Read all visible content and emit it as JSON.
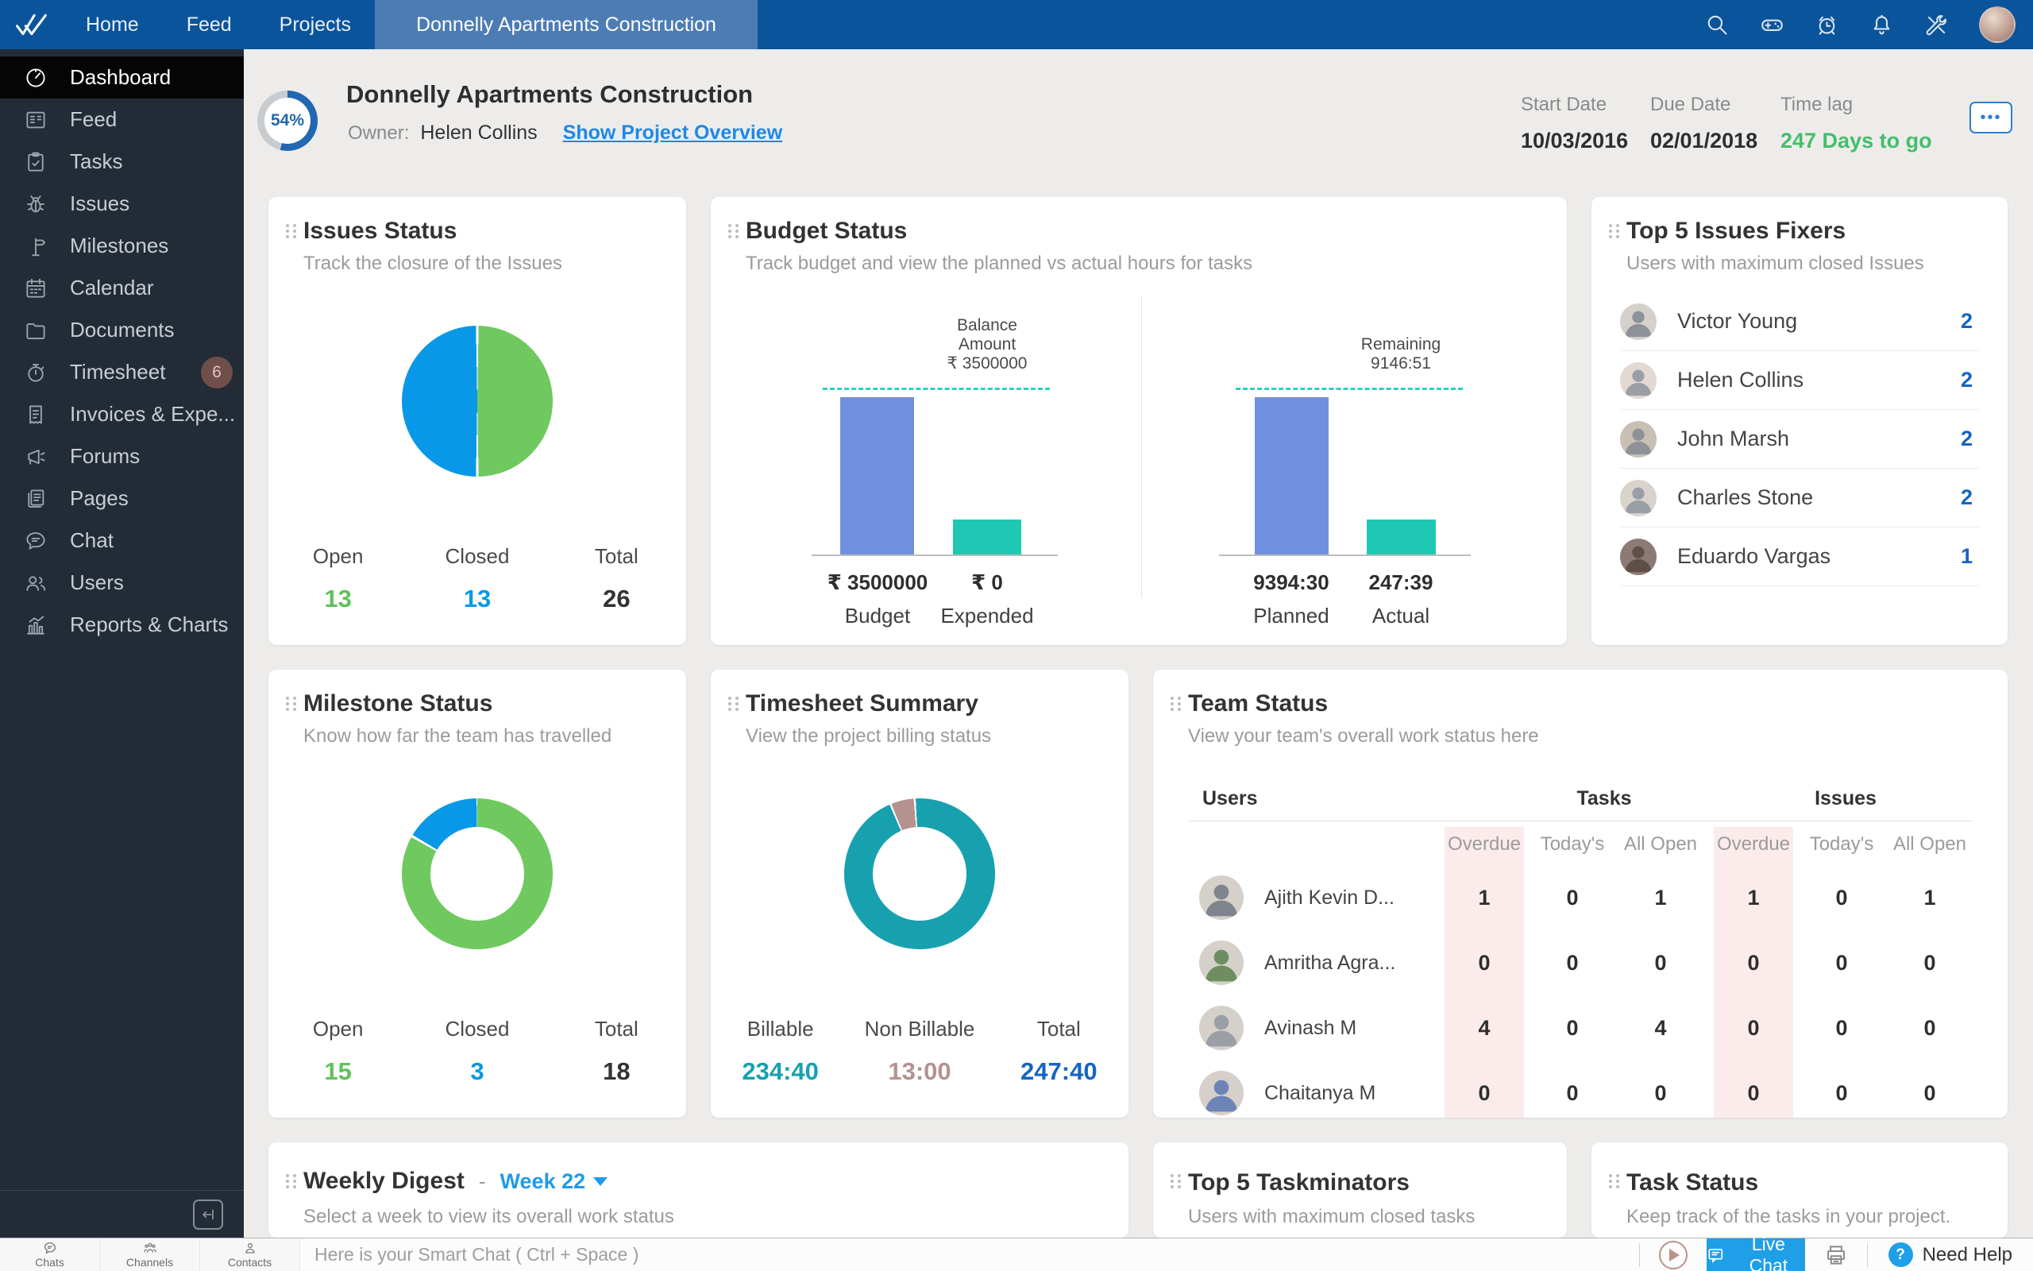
{
  "nav": {
    "tabs": [
      {
        "label": "Home"
      },
      {
        "label": "Feed"
      },
      {
        "label": "Projects"
      }
    ],
    "active_tab": "Donnelly Apartments Construction"
  },
  "sidebar": {
    "items": [
      {
        "label": "Dashboard"
      },
      {
        "label": "Feed"
      },
      {
        "label": "Tasks"
      },
      {
        "label": "Issues"
      },
      {
        "label": "Milestones"
      },
      {
        "label": "Calendar"
      },
      {
        "label": "Documents"
      },
      {
        "label": "Timesheet",
        "badge": "6"
      },
      {
        "label": "Invoices & Expe..."
      },
      {
        "label": "Forums"
      },
      {
        "label": "Pages"
      },
      {
        "label": "Chat"
      },
      {
        "label": "Users"
      },
      {
        "label": "Reports & Charts"
      }
    ]
  },
  "header": {
    "progress": "54%",
    "title": "Donnelly Apartments Construction",
    "owner_label": "Owner:",
    "owner_name": "Helen Collins",
    "overview_link": "Show Project Overview",
    "start_date_label": "Start Date",
    "start_date": "10/03/2016",
    "due_date_label": "Due Date",
    "due_date": "02/01/2018",
    "time_lag_label": "Time lag",
    "time_lag": "247 Days to go",
    "more_glyph": "•••"
  },
  "cards": {
    "issues_status": {
      "title": "Issues Status",
      "subtitle": "Track the closure of the Issues",
      "open_label": "Open",
      "open_value": "13",
      "closed_label": "Closed",
      "closed_value": "13",
      "total_label": "Total",
      "total_value": "26"
    },
    "budget_status": {
      "title": "Budget Status",
      "subtitle": "Track budget and view the planned vs actual hours for tasks",
      "money": {
        "annotation": [
          "Balance",
          "Amount",
          "₹ 3500000"
        ],
        "bar1_value": "₹ 3500000",
        "bar1_label": "Budget",
        "bar2_value": "₹ 0",
        "bar2_label": "Expended"
      },
      "hours": {
        "annotation": [
          "Remaining",
          "9146:51"
        ],
        "bar1_value": "9394:30",
        "bar1_label": "Planned",
        "bar2_value": "247:39",
        "bar2_label": "Actual"
      }
    },
    "top_issues_fixers": {
      "title": "Top 5 Issues Fixers",
      "subtitle": "Users with maximum closed Issues",
      "rows": [
        {
          "name": "Victor Young",
          "count": "2"
        },
        {
          "name": "Helen Collins",
          "count": "2"
        },
        {
          "name": "John Marsh",
          "count": "2"
        },
        {
          "name": "Charles Stone",
          "count": "2"
        },
        {
          "name": "Eduardo Vargas",
          "count": "1"
        }
      ]
    },
    "milestone_status": {
      "title": "Milestone Status",
      "subtitle": "Know how far the team has travelled",
      "open_label": "Open",
      "open_value": "15",
      "closed_label": "Closed",
      "closed_value": "3",
      "total_label": "Total",
      "total_value": "18"
    },
    "timesheet_summary": {
      "title": "Timesheet Summary",
      "subtitle": "View the project billing status",
      "billable_label": "Billable",
      "billable_value": "234:40",
      "non_billable_label": "Non Billable",
      "non_billable_value": "13:00",
      "total_label": "Total",
      "total_value": "247:40"
    },
    "team_status": {
      "title": "Team Status",
      "subtitle": "View your team's overall work status here",
      "users_header": "Users",
      "tasks_header": "Tasks",
      "issues_header": "Issues",
      "sub_headers": [
        "Overdue",
        "Today's",
        "All Open",
        "Overdue",
        "Today's",
        "All Open"
      ],
      "rows": [
        {
          "name": "Ajith Kevin D...",
          "values": [
            "1",
            "0",
            "1",
            "1",
            "0",
            "1"
          ]
        },
        {
          "name": "Amritha Agra...",
          "values": [
            "0",
            "0",
            "0",
            "0",
            "0",
            "0"
          ]
        },
        {
          "name": "Avinash M",
          "values": [
            "4",
            "0",
            "4",
            "0",
            "0",
            "0"
          ]
        },
        {
          "name": "Chaitanya M",
          "values": [
            "0",
            "0",
            "0",
            "0",
            "0",
            "0"
          ]
        }
      ]
    },
    "weekly_digest": {
      "title": "Weekly Digest",
      "separator": "-",
      "week_selector": "Week 22",
      "subtitle": "Select a week to view its overall work status"
    },
    "top_taskminators": {
      "title": "Top 5 Taskminators",
      "subtitle": "Users with maximum closed tasks"
    },
    "task_status": {
      "title": "Task Status",
      "subtitle": "Keep track of the tasks in your project."
    }
  },
  "bottom_bar": {
    "tabs": [
      {
        "label": "Chats"
      },
      {
        "label": "Channels"
      },
      {
        "label": "Contacts"
      }
    ],
    "smart_chat_placeholder": "Here is your Smart Chat ( Ctrl + Space )",
    "live_chat_label": "Live Chat",
    "help_glyph": "?",
    "need_help_label": "Need Help"
  },
  "chart_data": [
    {
      "id": "issues-status-pie",
      "type": "pie",
      "title": "Issues Status",
      "categories": [
        "Open",
        "Closed"
      ],
      "values": [
        13,
        13
      ],
      "total": 26,
      "colors": [
        "#6FC95F",
        "#0998E7"
      ],
      "legend_position": "bottom"
    },
    {
      "id": "milestone-status-donut",
      "type": "pie",
      "title": "Milestone Status",
      "categories": [
        "Open",
        "Closed"
      ],
      "values": [
        15,
        3
      ],
      "total": 18,
      "colors": [
        "#6FC95F",
        "#0998E7"
      ],
      "legend_position": "bottom"
    },
    {
      "id": "timesheet-summary-donut",
      "type": "pie",
      "title": "Timesheet Summary",
      "categories": [
        "Billable",
        "Non Billable"
      ],
      "values": [
        "234:40",
        "13:00"
      ],
      "total": "247:40",
      "colors": [
        "#17A1AF",
        "#B49290"
      ],
      "legend_position": "bottom"
    },
    {
      "id": "budget-status-bars",
      "type": "bar",
      "title": "Budget Status",
      "series": [
        {
          "group": "Cost",
          "categories": [
            "Budget",
            "Expended"
          ],
          "values": [
            3500000,
            0
          ],
          "display_values": [
            "₹ 3500000",
            "₹ 0"
          ],
          "annotation": "Balance Amount ₹ 3500000"
        },
        {
          "group": "Hours",
          "categories": [
            "Planned",
            "Actual"
          ],
          "values": [
            "9394:30",
            "247:39"
          ],
          "annotation": "Remaining 9146:51"
        }
      ],
      "colors": [
        "#7090DF",
        "#1FC8B3"
      ]
    }
  ],
  "colors": {
    "nav_bg": "#0A549C",
    "nav_active_tab": "#4C7CB3",
    "sidebar_bg": "#232C36",
    "sidebar_active_bg": "#050505",
    "page_bg": "#EDECEA",
    "card_bg": "#FFFFFF",
    "accent_blue": "#0998E7",
    "accent_green": "#6FC95F",
    "bar_blue": "#7090DF",
    "bar_teal": "#1FC8B3",
    "donut_teal": "#17A1AF",
    "donut_mauve": "#B49290",
    "count_blue": "#1565C0",
    "time_lag_green": "#42BE6B",
    "live_chat_blue": "#1F9FE8",
    "overdue_pink": "#FBECEB"
  }
}
